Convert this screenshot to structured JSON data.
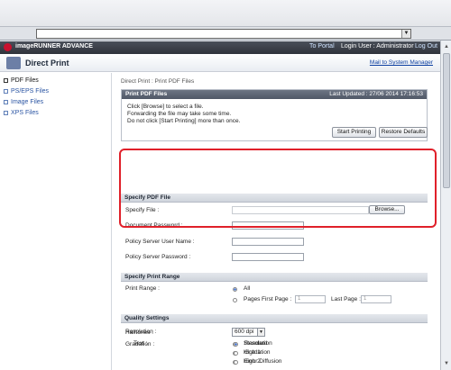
{
  "browser": {
    "scroll_up": "▲",
    "scroll_down": "▼"
  },
  "header": {
    "app_name": "imageRUNNER ADVANCE",
    "to_portal": "To Portal",
    "login_user": "Login User : Administrator",
    "logout": "Log Out",
    "page_title": "Direct Print",
    "mail_link": "Mail to System Manager"
  },
  "sidebar": {
    "items": [
      {
        "label": "PDF Files"
      },
      {
        "label": "PS/EPS Files"
      },
      {
        "label": "Image Files"
      },
      {
        "label": "XPS Files"
      }
    ]
  },
  "breadcrumb": "Direct Print : Print PDF Files",
  "print_panel": {
    "title": "Print PDF Files",
    "last_updated": "Last Updated : 27/06 2014 17:16:53",
    "lines": [
      "Click [Browse] to select a file.",
      "Forwarding the file may take some time.",
      "Do not click [Start Printing] more than once."
    ],
    "start_button": "Start Printing",
    "restore_button": "Restore Defaults"
  },
  "specify_file": {
    "title": "Specify PDF File",
    "file_label": "Specify File :",
    "browse_button": "Browse...",
    "doc_password_label": "Document Password :",
    "policy_user_label": "Policy Server User Name :",
    "policy_password_label": "Policy Server Password :"
  },
  "print_range": {
    "title": "Specify Print Range",
    "label": "Print Range :",
    "all": "All",
    "pages": "Pages",
    "first_page_label": "First Page :",
    "first_page_value": "1",
    "last_page_label": "Last Page :",
    "last_page_value": "1"
  },
  "quality": {
    "title": "Quality Settings",
    "resolution_label": "Resolution :",
    "resolution_value": "600 dpi",
    "gradation_label": "Gradation :",
    "gradation_options": [
      "Standard",
      "High 1",
      "High 2"
    ],
    "gradation_selected": "High 1",
    "halftones_label": "Halftones :",
    "text_label": "Text :",
    "text_options": [
      "Resolution",
      "Gradation",
      "Error Diffusion"
    ],
    "text_selected": "Resolution"
  },
  "colors": {
    "highlight": "#e0202a",
    "link": "#0b3ea0"
  }
}
